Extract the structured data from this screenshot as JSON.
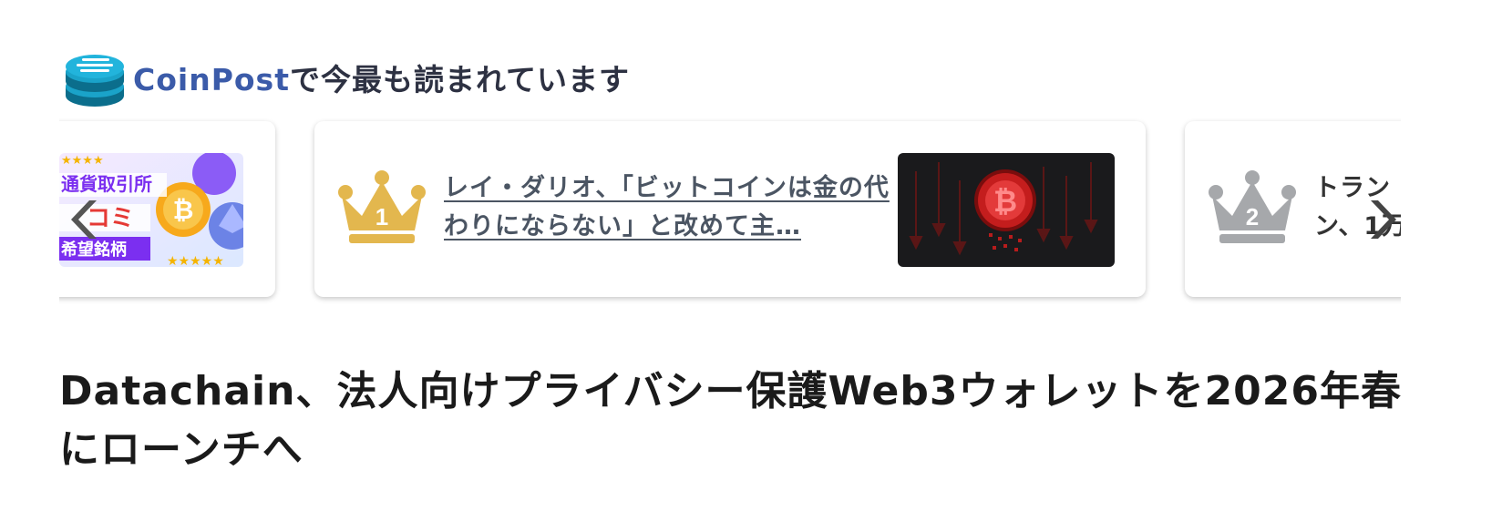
{
  "header": {
    "logo_icon": "coin-stack-icon",
    "brand": "CoinPost",
    "suffix": "で今最も読まれています"
  },
  "carousel": {
    "prev_icon": "chevron-left-icon",
    "next_icon": "chevron-right-icon",
    "items": [
      {
        "rank": "",
        "thumb_text": [
          "通貨取引所",
          "コミ",
          "希望銘柄"
        ]
      },
      {
        "rank": "1",
        "rank_icon": "gold-crown-icon",
        "title": "レイ・ダリオ、「ビットコインは金の代わりにならない」と改めて主…"
      },
      {
        "rank": "2",
        "rank_icon": "silver-crown-icon",
        "title_line1": "トラン",
        "title_line2": "ン、1万"
      }
    ]
  },
  "article": {
    "title": "Datachain、法人向けプライバシー保護Web3ウォレットを2026年春にローンチへ"
  },
  "colors": {
    "brand": "#3b5ba9",
    "gold": "#e3b74e",
    "silver": "#a6a8ab",
    "link": "#4b5563"
  }
}
